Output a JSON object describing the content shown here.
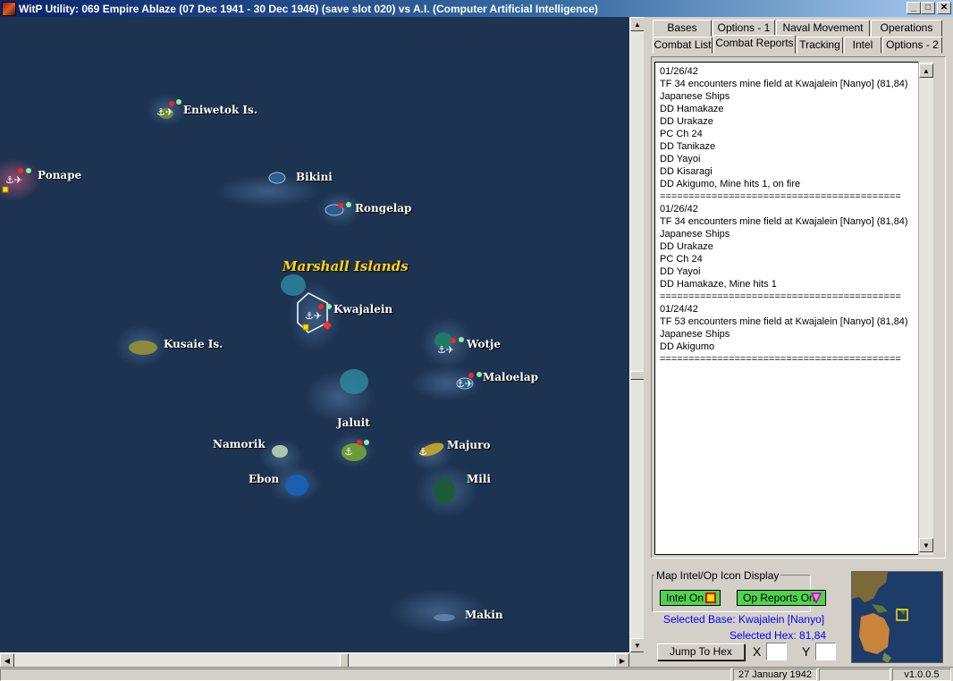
{
  "window": {
    "title": "WitP Utility:  069 Empire Ablaze (07 Dec 1941 - 30 Dec 1946) (save slot 020)  vs A.I. (Computer Artificial Intelligence)",
    "btn_min": "_",
    "btn_max": "□",
    "btn_close": "✕"
  },
  "map": {
    "region_label": "Marshall Islands",
    "bases": [
      {
        "name": "Eniwetok Is."
      },
      {
        "name": "Ponape"
      },
      {
        "name": "Bikini"
      },
      {
        "name": "Rongelap"
      },
      {
        "name": "Kwajalein"
      },
      {
        "name": "Kusaie Is."
      },
      {
        "name": "Wotje"
      },
      {
        "name": "Maloelap"
      },
      {
        "name": "Jaluit"
      },
      {
        "name": "Namorik"
      },
      {
        "name": "Majuro"
      },
      {
        "name": "Ebon"
      },
      {
        "name": "Mili"
      },
      {
        "name": "Makin"
      }
    ]
  },
  "tabs": {
    "row1": [
      "Bases",
      "Options - 1",
      "Naval Movement",
      "Operations"
    ],
    "row2": [
      "Combat List",
      "Combat Reports",
      "Tracking",
      "Intel",
      "Options - 2"
    ],
    "active": "Combat Reports"
  },
  "report_lines": [
    "01/26/42",
    "TF 34 encounters mine field at Kwajalein [Nanyo] (81,84)",
    "Japanese Ships",
    "DD Hamakaze",
    "DD Urakaze",
    "PC Ch 24",
    "DD Tanikaze",
    "DD Yayoi",
    "DD Kisaragi",
    "DD Akigumo, Mine hits 1,  on fire",
    "==========================================",
    "01/26/42",
    "TF 34 encounters mine field at Kwajalein [Nanyo] (81,84)",
    "Japanese Ships",
    "DD Urakaze",
    "PC Ch 24",
    "DD Yayoi",
    "DD Hamakaze, Mine hits 1",
    "==========================================",
    "01/24/42",
    "TF 53 encounters mine field at Kwajalein [Nanyo] (81,84)",
    "Japanese Ships",
    "DD Akigumo",
    "=========================================="
  ],
  "intel": {
    "group_label": "Map Intel/Op Icon Display",
    "intel_button": "Intel On",
    "opreports_button": "Op Reports On"
  },
  "selection": {
    "base_text": "Selected Base: Kwajalein [Nanyo]",
    "hex_text": "Selected Hex: 81,84"
  },
  "jump": {
    "button": "Jump To Hex",
    "x_label": "X",
    "y_label": "Y"
  },
  "status": {
    "date": "27 January 1942",
    "version": "v1.0.0.5"
  },
  "colors": {
    "ocean": "#1c3351",
    "region_label": "#f5d425",
    "toggle_green": "#4ed44e",
    "selection_blue": "#0000ff"
  }
}
